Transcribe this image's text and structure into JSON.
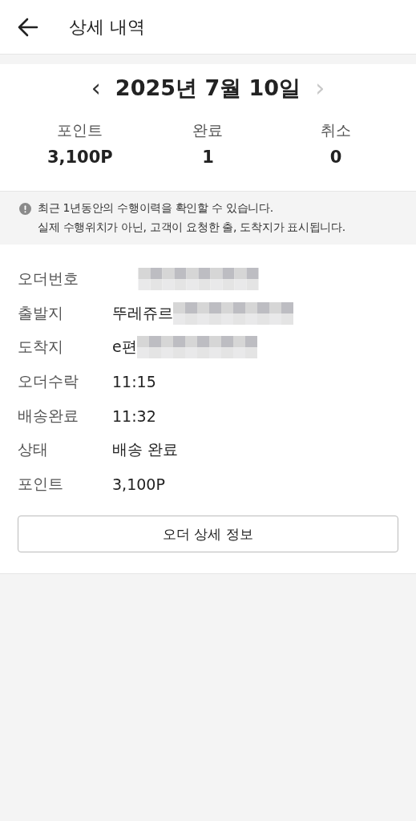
{
  "header": {
    "title": "상세 내역"
  },
  "date_nav": {
    "prev": "‹",
    "date": "2025년 7월 10일",
    "next": "›",
    "next_disabled": true
  },
  "summary": [
    {
      "label": "포인트",
      "value": "3,100P"
    },
    {
      "label": "완료",
      "value": "1"
    },
    {
      "label": "취소",
      "value": "0"
    }
  ],
  "notice": [
    "최근 1년동안의 수행이력을 확인할 수 있습니다.",
    "실제 수행위치가 아닌, 고객이 요청한 출, 도착지가 표시됩니다."
  ],
  "details": [
    {
      "label": "오더번호",
      "redacted": true
    },
    {
      "label": "출발지",
      "value": "뚜레쥬르",
      "redacted": true
    },
    {
      "label": "도착지",
      "value": "e편",
      "redacted": true
    },
    {
      "label": "오더수락",
      "value": "11:15",
      "redacted": false
    },
    {
      "label": "배송완료",
      "value": "11:32",
      "redacted": false
    },
    {
      "label": "상태",
      "value": "배송 완료",
      "redacted": false
    },
    {
      "label": "포인트",
      "value": "3,100P",
      "redacted": false
    }
  ],
  "button": {
    "label": "오더 상세 정보"
  }
}
